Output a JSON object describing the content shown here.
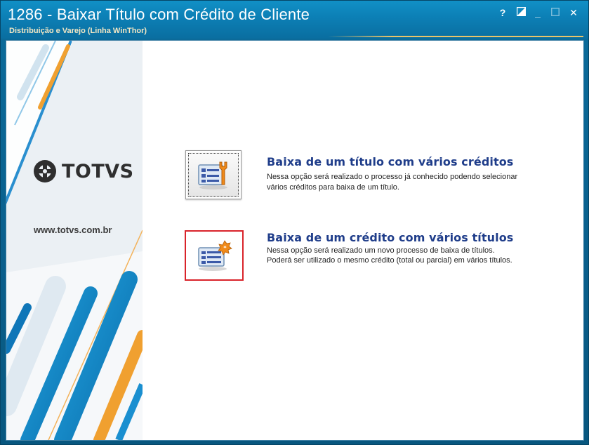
{
  "window": {
    "title": "1286 - Baixar Título com Crédito de Cliente",
    "subtitle": "Distribuição e Varejo (Linha WinThor)",
    "controls": {
      "help": "?",
      "minimize": "_",
      "close": "✕"
    }
  },
  "sidebar": {
    "logo_text": "TOTVS",
    "website": "www.totvs.com.br"
  },
  "options": [
    {
      "title": "Baixa de um título com vários créditos",
      "desc_line1": "Nessa opção será realizado o processo já conhecido podendo selecionar",
      "desc_line2": "vários créditos para baixa de um título.",
      "icon": "document-wrench-icon"
    },
    {
      "title": "Baixa de um crédito com vários títulos",
      "desc_line1": "Nessa opção será realizado um novo processo de baixa de títulos.",
      "desc_line2": "Poderá ser utilizado o mesmo crédito (total ou parcial) em vários títulos.",
      "icon": "document-new-badge-icon"
    }
  ],
  "colors": {
    "titlebar": "#0c7fb5",
    "option_title": "#1f3d8a",
    "highlight_border": "#d9232a",
    "accent_orange": "#f0a030",
    "accent_blue": "#1a8fd0"
  }
}
